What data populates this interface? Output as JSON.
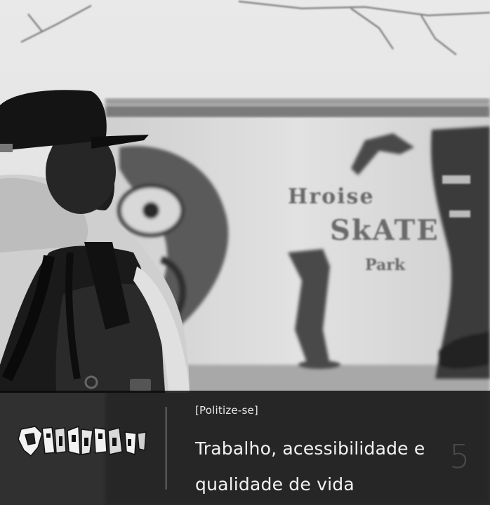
{
  "post": {
    "category": "[Politize-se]",
    "title": "Trabalho, acessibilidade e qualidade de vida",
    "number": "5"
  },
  "logo": {
    "text": "QUEBRADA TV"
  },
  "colors": {
    "overlay": "#0a0a0a",
    "text": "#f2f2f2",
    "number": "#4a4a4a",
    "divider": "#bdbdbd"
  },
  "icons": {
    "logo": "quebrada-tv-logo"
  }
}
